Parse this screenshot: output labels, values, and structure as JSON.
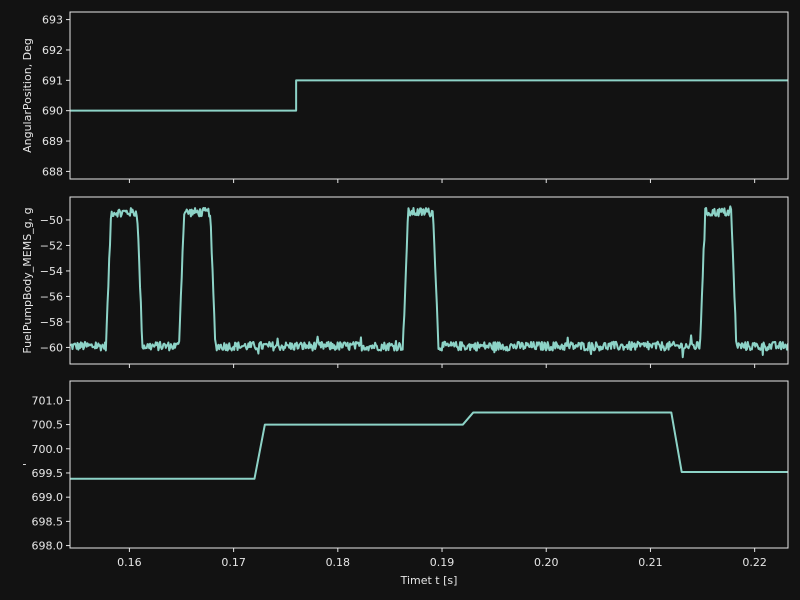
{
  "chart_data": [
    {
      "type": "line",
      "ylabel": "AngularPosition, Deg",
      "xlim": [
        0.1543,
        0.2232
      ],
      "ylim": [
        687.75,
        693.25
      ],
      "yticks": [
        "688",
        "689",
        "690",
        "691",
        "692",
        "693"
      ],
      "ytick_values": [
        688,
        689,
        690,
        691,
        692,
        693
      ],
      "series": [
        {
          "color": "#8dd3c7",
          "x": [
            0.1543,
            0.176,
            0.176,
            0.2232
          ],
          "y": [
            690,
            690,
            691,
            691
          ]
        }
      ]
    },
    {
      "type": "line",
      "ylabel": "FuelPumpBody_MEMS_g, g",
      "xlim": [
        0.1543,
        0.2232
      ],
      "ylim": [
        -61.3,
        -48.2
      ],
      "yticks": [
        "−60",
        "−58",
        "−56",
        "−54",
        "−52",
        "−50"
      ],
      "ytick_values": [
        -60,
        -58,
        -56,
        -54,
        -52,
        -50
      ],
      "pulses": [
        [
          0.158,
          0.161
        ],
        [
          0.165,
          0.168
        ],
        [
          0.1865,
          0.1894
        ],
        [
          0.215,
          0.218
        ]
      ],
      "high_level": -49.4,
      "low_level": -59.9,
      "noise_amplitude": 0.35,
      "series": [
        {
          "color": "#8dd3c7"
        }
      ]
    },
    {
      "type": "line",
      "ylabel": "'",
      "xlabel": "Timet t [s]",
      "xlim": [
        0.1543,
        0.2232
      ],
      "ylim": [
        697.95,
        701.4
      ],
      "yticks": [
        "698.0",
        "698.5",
        "699.0",
        "699.5",
        "700.0",
        "700.5",
        "701.0"
      ],
      "ytick_values": [
        698.0,
        698.5,
        699.0,
        699.5,
        700.0,
        700.5,
        701.0
      ],
      "xticks": [
        "0.16",
        "0.17",
        "0.18",
        "0.19",
        "0.20",
        "0.21",
        "0.22"
      ],
      "xtick_values": [
        0.16,
        0.17,
        0.18,
        0.19,
        0.2,
        0.21,
        0.22
      ],
      "series": [
        {
          "color": "#8dd3c7",
          "x": [
            0.1543,
            0.172,
            0.173,
            0.192,
            0.193,
            0.212,
            0.213,
            0.2232
          ],
          "y": [
            699.38,
            699.38,
            700.5,
            700.5,
            700.75,
            700.75,
            699.52,
            699.52
          ]
        }
      ]
    }
  ]
}
